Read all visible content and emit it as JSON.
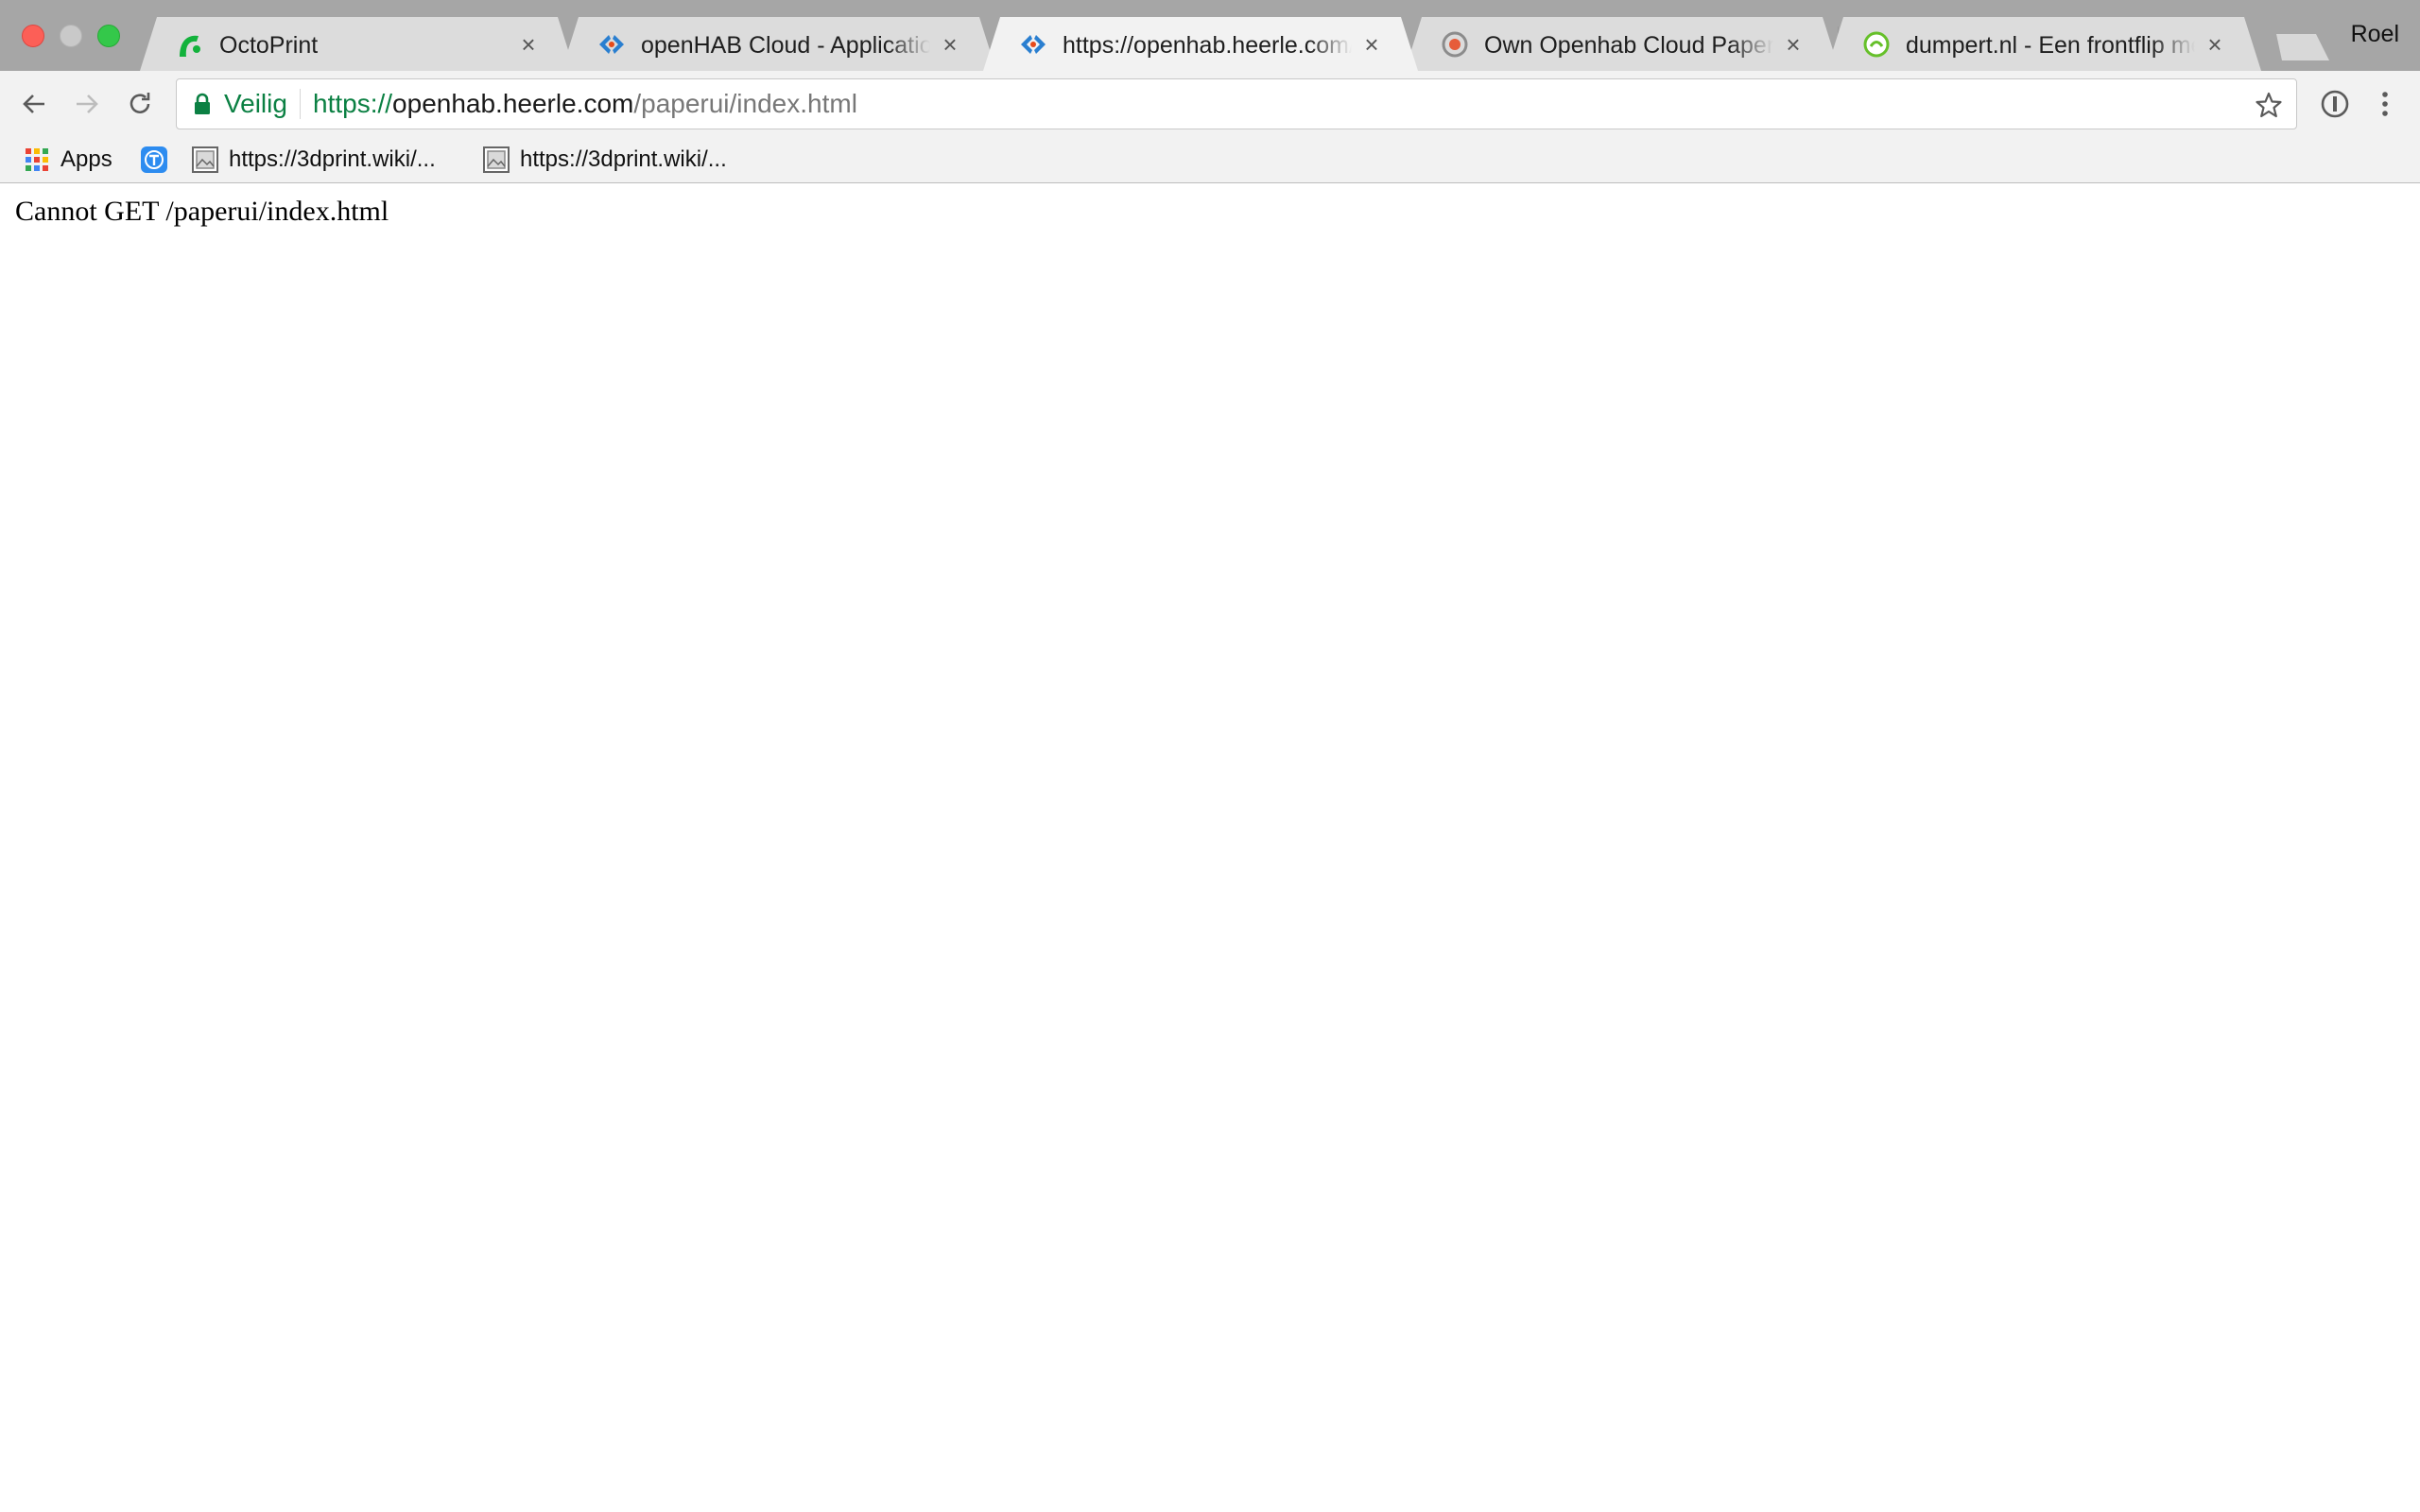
{
  "tabs": [
    {
      "title": "OctoPrint",
      "close": "×",
      "icon": "octoprint-icon",
      "active": false
    },
    {
      "title": "openHAB Cloud - Applications",
      "close": "×",
      "icon": "openhab-icon",
      "active": false
    },
    {
      "title": "https://openhab.heerle.com/paperui/index.html",
      "close": "×",
      "icon": "openhab-icon",
      "active": true
    },
    {
      "title": "Own Openhab Cloud PaperUI",
      "close": "×",
      "icon": "community-icon",
      "active": false
    },
    {
      "title": "dumpert.nl - Een frontflip met",
      "close": "×",
      "icon": "dumpert-icon",
      "active": false
    }
  ],
  "profile": {
    "name": "Roel"
  },
  "omnibox": {
    "security_label": "Veilig",
    "url_scheme": "https://",
    "url_host": "openhab.heerle.com",
    "url_path": "/paperui/index.html"
  },
  "bookmarks": [
    {
      "label": "Apps",
      "icon": "apps-grid-icon"
    },
    {
      "label": "",
      "icon": "translate-icon"
    },
    {
      "label": "https://3dprint.wiki/...",
      "icon": "page-icon"
    },
    {
      "label": "https://3dprint.wiki/...",
      "icon": "page-icon"
    }
  ],
  "page": {
    "message": "Cannot GET /paperui/index.html"
  },
  "colors": {
    "secure_green": "#0b8043",
    "tabstrip": "#a6a6a6",
    "toolbar": "#f2f2f2"
  }
}
